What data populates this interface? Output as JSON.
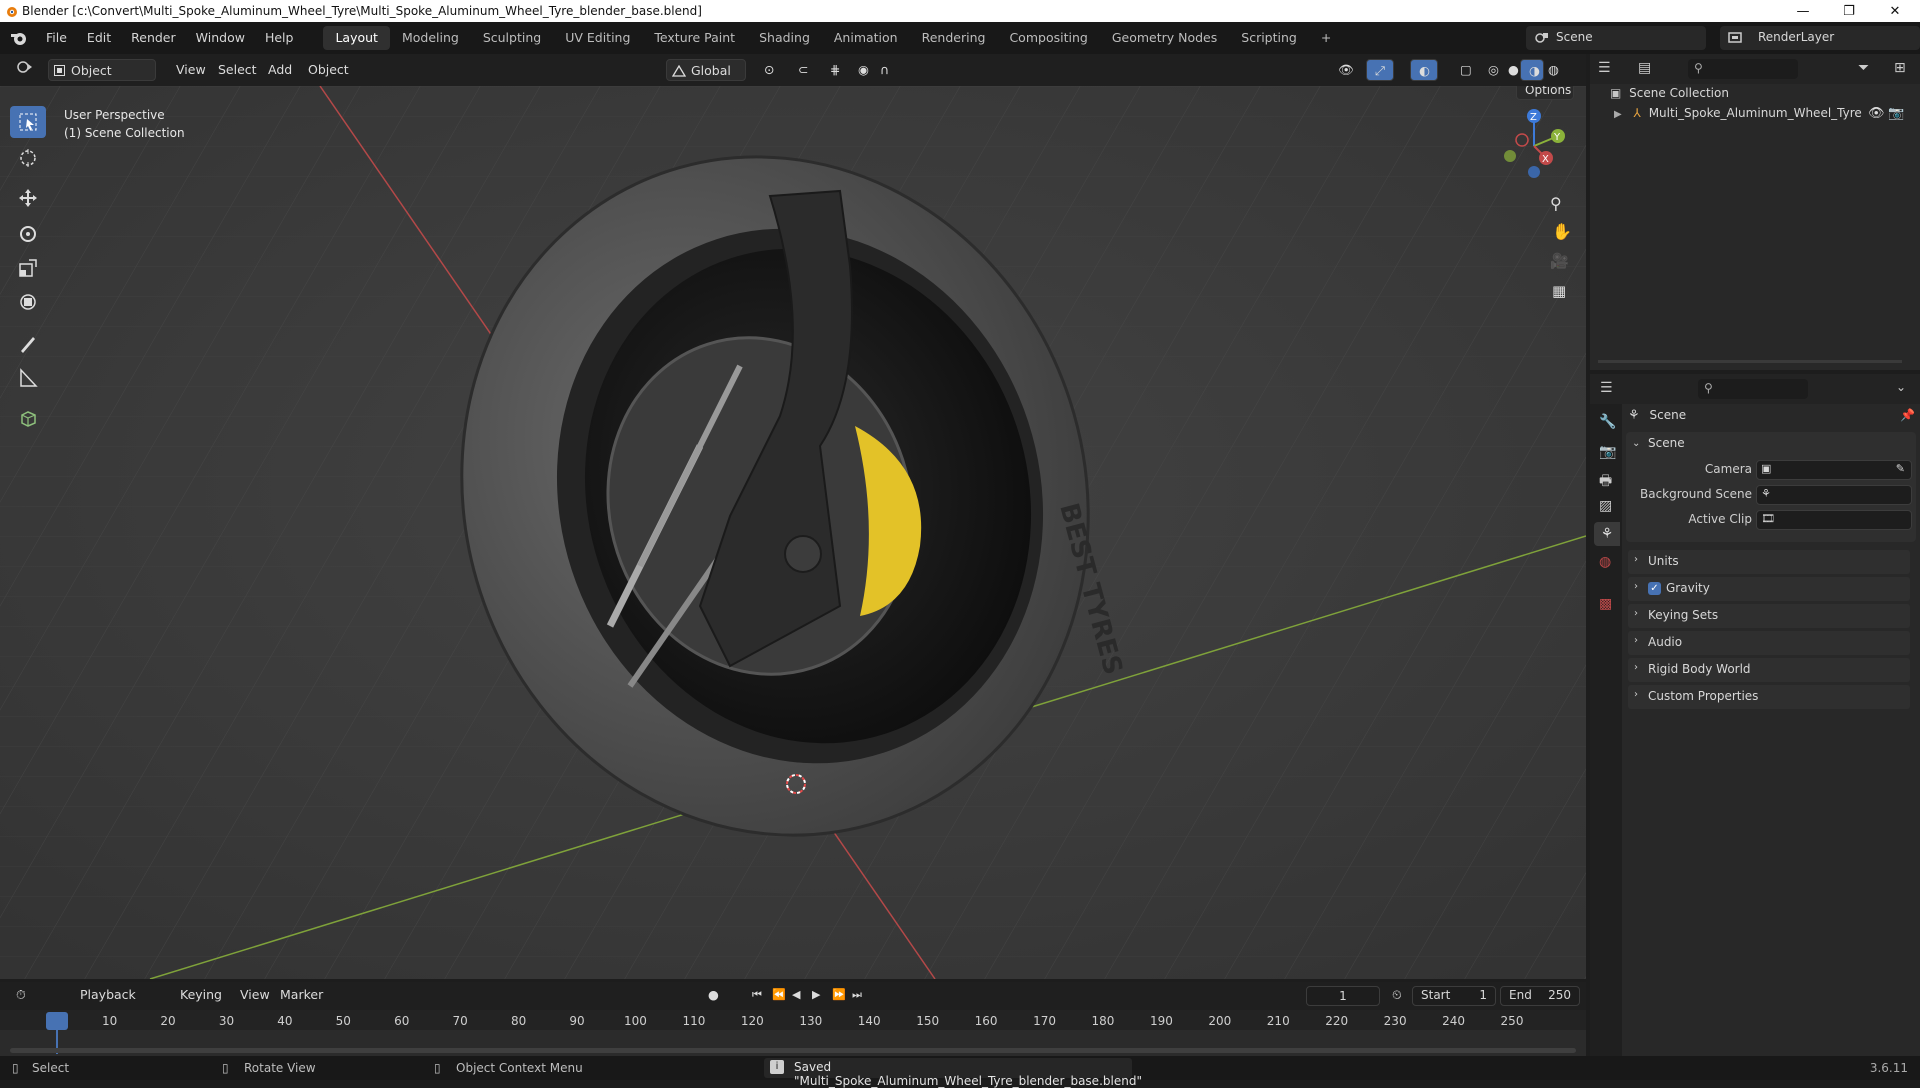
{
  "window": {
    "title": "Blender [c:\\Convert\\Multi_Spoke_Aluminum_Wheel_Tyre\\Multi_Spoke_Aluminum_Wheel_Tyre_blender_base.blend]",
    "minimize": "—",
    "maximize": "❐",
    "close": "✕"
  },
  "menu": [
    "File",
    "Edit",
    "Render",
    "Window",
    "Help"
  ],
  "workspaces": [
    "Layout",
    "Modeling",
    "Sculpting",
    "UV Editing",
    "Texture Paint",
    "Shading",
    "Animation",
    "Rendering",
    "Compositing",
    "Geometry Nodes",
    "Scripting"
  ],
  "workspace_add": "+",
  "active_workspace": "Layout",
  "scene_selector": "Scene",
  "render_layer": "RenderLayer",
  "viewport": {
    "mode": "Object Mode",
    "header_menu": [
      "View",
      "Select",
      "Add",
      "Object"
    ],
    "transform_orientation": "Global",
    "options": "Options",
    "overlay_line1": "User Perspective",
    "overlay_line2": "(1) Scene Collection",
    "gizmo": {
      "x": "X",
      "y": "Y",
      "z": "Z"
    },
    "tire_text": "BEST TYRES"
  },
  "outliner": {
    "root": "Scene Collection",
    "items": [
      "Multi_Spoke_Aluminum_Wheel_Tyre"
    ]
  },
  "properties": {
    "header": "Scene",
    "panel_title": "Scene",
    "fields": [
      {
        "label": "Camera"
      },
      {
        "label": "Background Scene"
      },
      {
        "label": "Active Clip"
      }
    ],
    "sections": [
      "Units",
      "Gravity",
      "Keying Sets",
      "Audio",
      "Rigid Body World",
      "Custom Properties"
    ],
    "gravity_checked": true
  },
  "timeline": {
    "menus": [
      "Playback",
      "Keying",
      "View",
      "Marker"
    ],
    "current_frame": "1",
    "start_label": "Start",
    "start": "1",
    "end_label": "End",
    "end": "250",
    "ticks": [
      "1",
      "10",
      "20",
      "30",
      "40",
      "50",
      "60",
      "70",
      "80",
      "90",
      "100",
      "110",
      "120",
      "130",
      "140",
      "150",
      "160",
      "170",
      "180",
      "190",
      "200",
      "210",
      "220",
      "230",
      "240",
      "250"
    ]
  },
  "status": {
    "select": "Select",
    "rotate": "Rotate View",
    "context": "Object Context Menu",
    "message": "Saved \"Multi_Spoke_Aluminum_Wheel_Tyre_blender_base.blend\"",
    "version": "3.6.11"
  },
  "colors": {
    "accent": "#4772b3",
    "x_axis": "#c24a4a",
    "y_axis": "#8bb23a",
    "z_axis": "#3d7ad9",
    "caliper": "#e3c228"
  }
}
